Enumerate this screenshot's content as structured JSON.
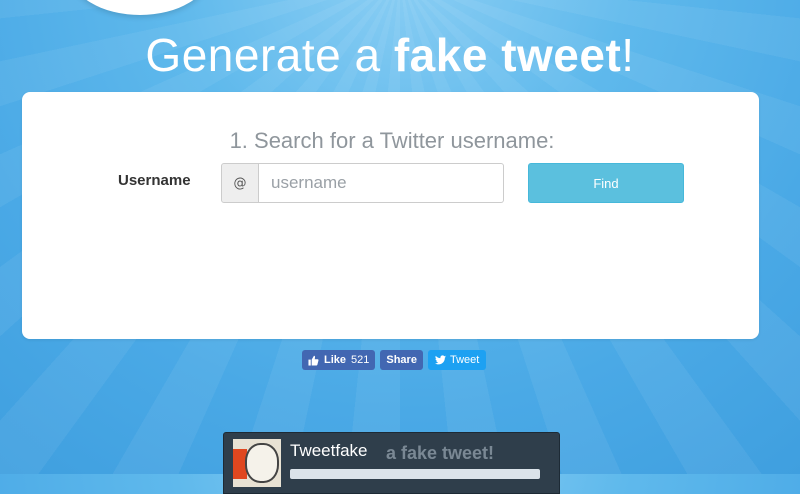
{
  "header": {
    "title_prefix": "Generate a ",
    "title_bold": "fake tweet",
    "title_suffix": "!"
  },
  "search": {
    "heading": "1. Search for a Twitter username:",
    "label": "Username",
    "addon": "@",
    "placeholder": "username",
    "value": "",
    "button": "Find"
  },
  "social": {
    "like_label": "Like",
    "like_count": "521",
    "share_label": "Share",
    "tweet_label": "Tweet"
  },
  "preview": {
    "title": "Tweetfake",
    "ghost_text": "a fake tweet!"
  },
  "colors": {
    "background": "#4aa9e6",
    "find_button": "#5bc0de",
    "facebook": "#4267b2",
    "twitter": "#1da1f2"
  }
}
